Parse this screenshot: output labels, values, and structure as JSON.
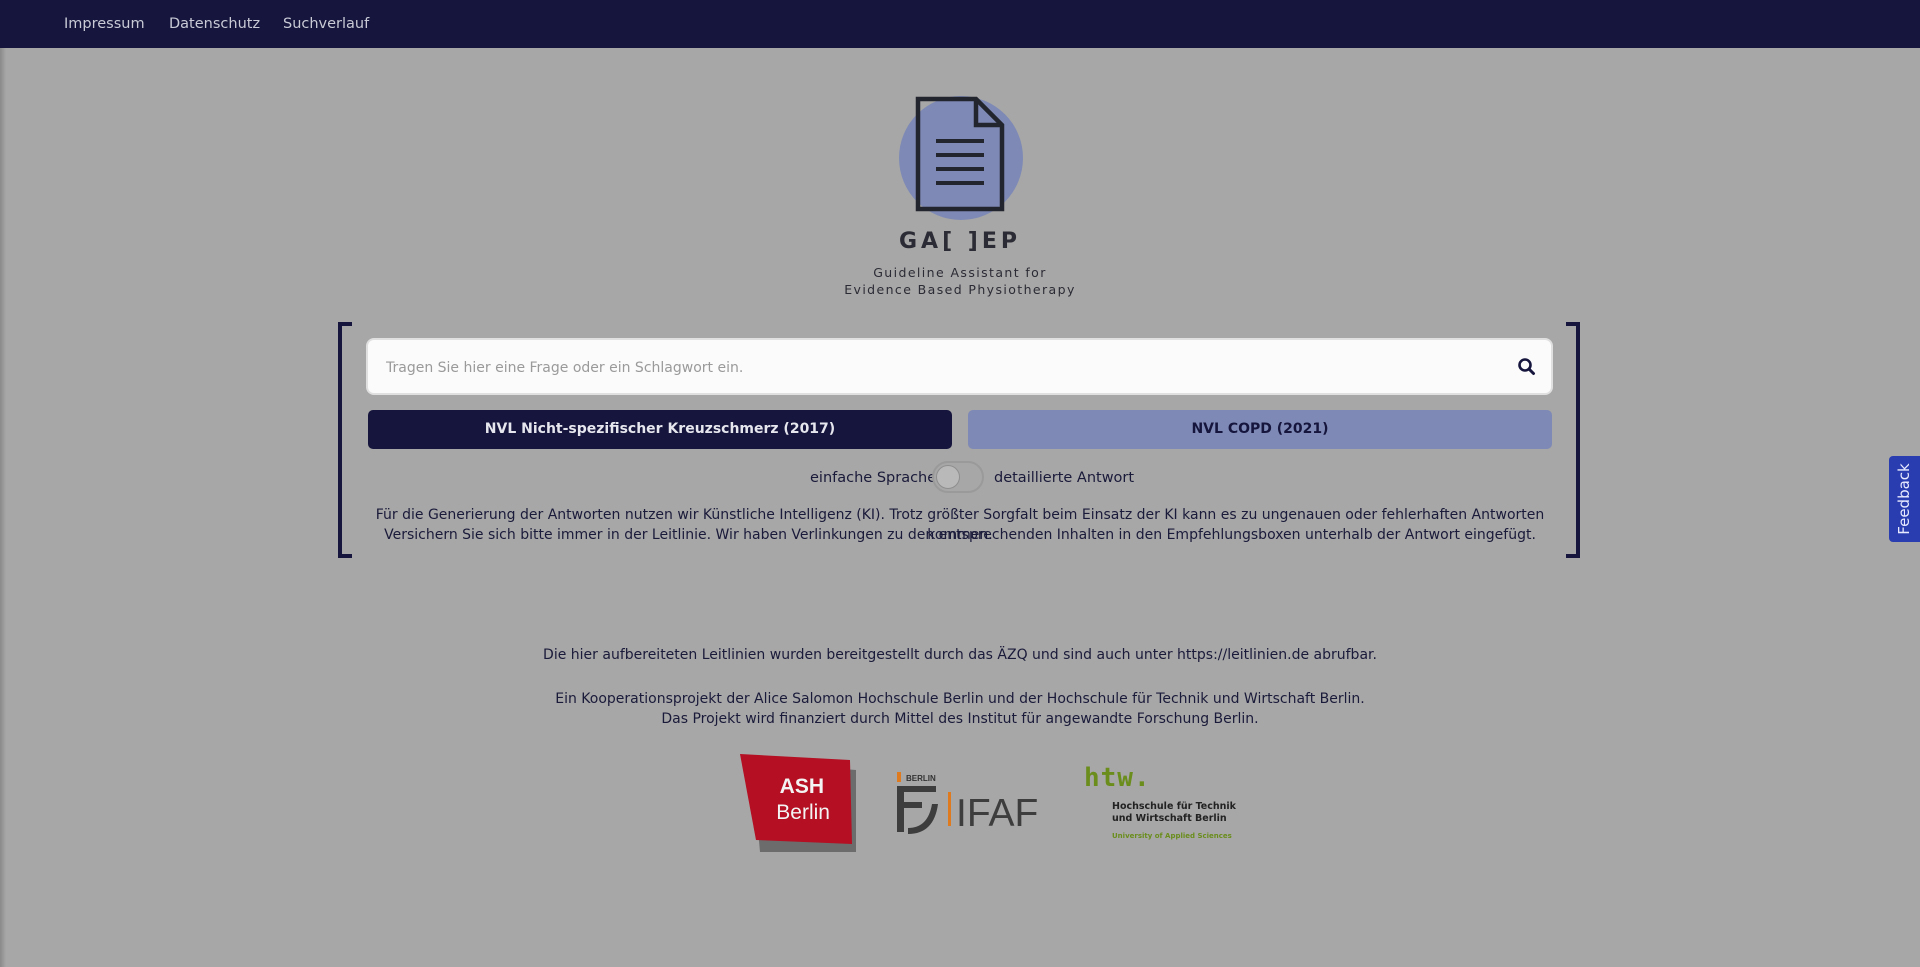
{
  "nav": {
    "items": [
      {
        "label": "Impressum"
      },
      {
        "label": "Datenschutz"
      },
      {
        "label": "Suchverlauf"
      }
    ]
  },
  "brand": {
    "logo_icon": "document-icon",
    "title": "GA[ ]EP",
    "subtitle_line1": "Guideline Assistant for",
    "subtitle_line2": "Evidence Based Physiotherapy"
  },
  "search": {
    "placeholder": "Tragen Sie hier eine Frage oder ein Schlagwort ein.",
    "value": "",
    "button_icon": "search-icon"
  },
  "guidelines": [
    {
      "label": "NVL Nicht-spezifischer Kreuzschmerz (2017)",
      "selected": true
    },
    {
      "label": "NVL COPD (2021)",
      "selected": false
    }
  ],
  "toggle": {
    "left_label": "einfache Sprache",
    "right_label": "detaillierte Antwort",
    "state": "einfache Sprache"
  },
  "disclaimer": {
    "line1": "Für die Generierung der Antworten nutzen wir Künstliche Intelligenz (KI). Trotz größter Sorgfalt beim Einsatz der KI kann es zu ungenauen oder fehlerhaften Antworten kommen.",
    "line2": "Versichern Sie sich bitte immer in der Leitlinie. Wir haben Verlinkungen zu den entsprechenden Inhalten in den Empfehlungsboxen unterhalb der Antwort eingefügt."
  },
  "footer": {
    "source_line": "Die hier aufbereiteten Leitlinien wurden bereitgestellt durch das ÄZQ und sind auch unter https://leitlinien.de abrufbar.",
    "coop_line": "Ein Kooperationsprojekt der Alice Salomon Hochschule Berlin und der Hochschule für Technik und Wirtschaft Berlin.",
    "funding_line": "Das Projekt wird finanziert durch Mittel des Institut für angewandte Forschung Berlin."
  },
  "partners": {
    "ash": {
      "line1": "ASH",
      "line2": "Berlin",
      "color": "#c8102e"
    },
    "ifaf": {
      "small": "BERLIN",
      "name": "IFAF"
    },
    "htw": {
      "mark": "htw.",
      "line1": "Hochschule für Technik",
      "line2": "und Wirtschaft Berlin",
      "line3": "University of Applied Sciences",
      "color": "#6a8d1c"
    }
  },
  "feedback": {
    "label": "Feedback"
  },
  "colors": {
    "navy": "#15153d",
    "periwinkle": "#7e8ab5",
    "background": "#a7a7a7",
    "feedback_blue": "#2a3db0"
  }
}
